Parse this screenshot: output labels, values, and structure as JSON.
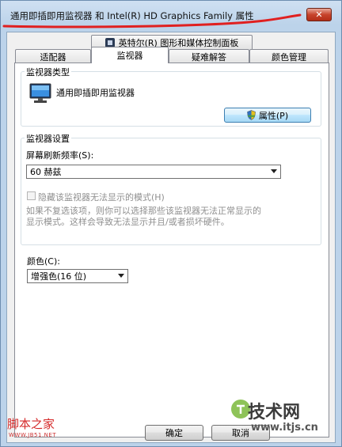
{
  "window": {
    "title": "通用即插即用监视器 和 Intel(R) HD Graphics Family 属性",
    "close_glyph": "✕"
  },
  "tabs_row1": [
    {
      "label": "英特尔(R) 图形和媒体控制面板",
      "icon": "intel-graphics-icon"
    }
  ],
  "tabs_row2": [
    {
      "label": "适配器",
      "active": false
    },
    {
      "label": "监视器",
      "active": true
    },
    {
      "label": "疑难解答",
      "active": false
    },
    {
      "label": "颜色管理",
      "active": false
    }
  ],
  "monitor_type": {
    "group_label": "监视器类型",
    "monitor_name": "通用即插即用监视器",
    "properties_button": "属性(P)",
    "icon": "monitor-icon"
  },
  "monitor_settings": {
    "group_label": "监视器设置",
    "refresh_label": "屏幕刷新频率(S):",
    "refresh_value": "60 赫兹",
    "hide_modes_label": "隐藏该监视器无法显示的模式(H)",
    "hide_modes_checked": false,
    "description_line1": "如果不复选该项，则你可以选择那些该监视器无法正常显示的",
    "description_line2": "显示模式。这样会导致无法显示并且/或者损坏硬件。"
  },
  "color": {
    "label": "颜色(C):",
    "value": "增强色(16 位)"
  },
  "footer": {
    "ok_button": "确定",
    "cancel_button": "取消"
  },
  "watermarks": {
    "left_text": "脚本之家",
    "left_sub": "WWW.JB51.NET",
    "right_text": "技术网",
    "right_sub": "www.itjs.cn"
  },
  "colors": {
    "title_underline": "#e02020",
    "close_button": "#c7442c",
    "panel_bg": "#ffffff",
    "window_frame": "#bcd3ea"
  }
}
